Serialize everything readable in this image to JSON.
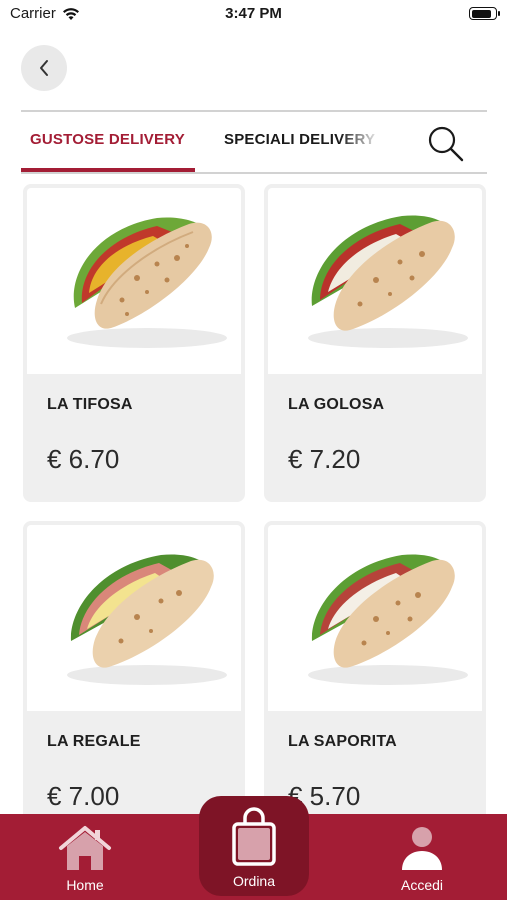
{
  "status_bar": {
    "carrier": "Carrier",
    "time": "3:47 PM",
    "battery_level": 0.9
  },
  "header": {
    "back_icon": "chevron-left-icon"
  },
  "tabs": [
    {
      "label": "GUSTOSE DELIVERY",
      "active": true
    },
    {
      "label": "SPECIALI DELIVERY",
      "active": false
    }
  ],
  "search_icon": "search-icon",
  "products": [
    {
      "name": "LA TIFOSA",
      "price": "€ 6.70"
    },
    {
      "name": "LA GOLOSA",
      "price": "€ 7.20"
    },
    {
      "name": "LA REGALE",
      "price": "€ 7.00"
    },
    {
      "name": "LA SAPORITA",
      "price": "€ 5.70"
    }
  ],
  "bottom_nav": {
    "home": "Home",
    "ordina": "Ordina",
    "accedi": "Accedi"
  },
  "colors": {
    "brand": "#a31d35",
    "brand_dark": "#7e1426",
    "card_bg": "#efefef"
  }
}
